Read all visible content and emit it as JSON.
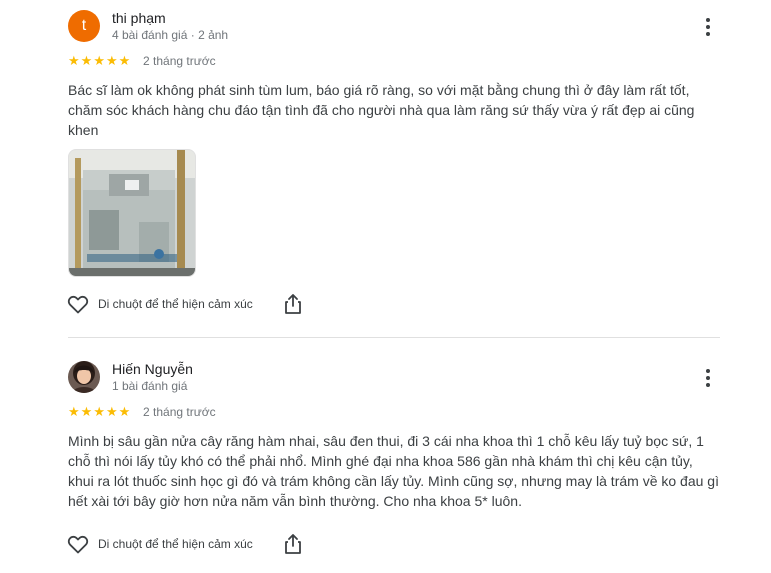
{
  "reviews": [
    {
      "avatar_letter": "t",
      "avatar_color": "#ef6c00",
      "author": "thi phạm",
      "meta": "4 bài đánh giá · 2 ảnh",
      "rating": 5,
      "date": "2 tháng trước",
      "text": "Bác sĩ làm ok không phát sinh tùm lum, báo giá rõ ràng, so với mặt bằng chung thì ở đây làm rất tốt,\nchăm sóc khách hàng chu đáo tận tình đã cho người nhà qua làm răng sứ thấy vừa ý rất đẹp ai cũng\nkhen",
      "react_label": "Di chuột để thể hiện cảm xúc"
    },
    {
      "author": "Hiến Nguyễn",
      "meta": "1 bài đánh giá",
      "rating": 5,
      "date": "2 tháng trước",
      "text": "Mình bị sâu gần nửa cây răng hàm nhai, sâu đen thui, đi 3 cái nha khoa thì 1 chỗ kêu lấy tuỷ bọc sứ, 1\nchỗ thì nói lấy tủy khó có thể phải nhổ. Mình ghé đại nha khoa 586 gần nhà khám thì chị kêu cận tủy,\nkhui ra lót thuốc sinh học gì đó và trám không cần lấy tủy. Mình cũng sợ, nhưng may là trám về ko đau gì\nhết xài tới bây giờ hơn nửa năm vẫn bình thường. Cho nha khoa 5* luôn.",
      "react_label": "Di chuột để thể hiện cảm xúc"
    }
  ],
  "colors": {
    "star": "#fbbc04",
    "secondary_text": "#70757a",
    "divider": "#e0e0e0"
  },
  "icons": [
    "heart-outline-icon",
    "share-icon",
    "more-vert-icon",
    "star-icon"
  ]
}
